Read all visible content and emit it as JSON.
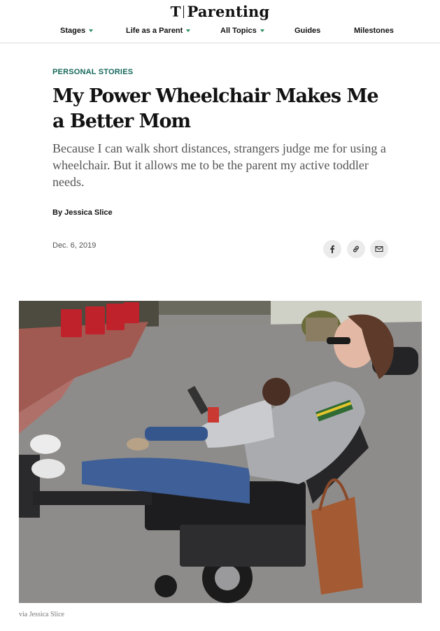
{
  "masthead": {
    "logo_mark": "T",
    "logo_word": "Parenting"
  },
  "nav": {
    "items": [
      {
        "label": "Stages",
        "has_menu": true
      },
      {
        "label": "Life as a Parent",
        "has_menu": true
      },
      {
        "label": "All Topics",
        "has_menu": true
      },
      {
        "label": "Guides",
        "has_menu": false
      },
      {
        "label": "Milestones",
        "has_menu": false
      }
    ]
  },
  "article": {
    "kicker": "PERSONAL STORIES",
    "headline": "My Power Wheelchair Makes Me a Better Mom",
    "summary": "Because I can walk short distances, strangers judge me for using a wheelchair. But it allows me to be the parent my active toddler needs.",
    "byline": "By Jessica Slice",
    "date": "Dec. 6, 2019",
    "share": [
      "facebook-icon",
      "link-icon",
      "email-icon"
    ],
    "photo_credit": "via Jessica Slice"
  },
  "colors": {
    "kicker": "#17695c",
    "caret": "#2a8e62",
    "summary": "#555555"
  }
}
